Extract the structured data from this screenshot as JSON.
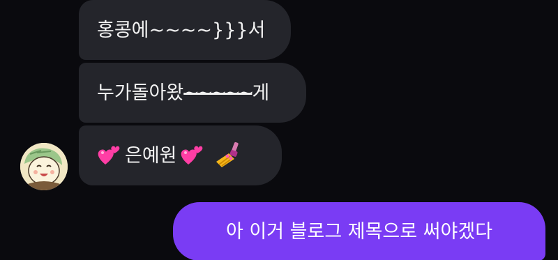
{
  "messages": {
    "m1": {
      "text": "홍콩에~~~~}}}서"
    },
    "m2": {
      "before": "누가돌아왔",
      "strike": "~~~~~",
      "after": "게"
    },
    "m3": {
      "emoji_left": "two-hearts-icon",
      "text": "은예원",
      "emoji_right": "two-hearts-icon",
      "emoji_end": "nail-polish-icon"
    },
    "m4": {
      "text": "아 이거 블로그 제목으로 써야겠다"
    }
  },
  "colors": {
    "background": "#0a0a0e",
    "incoming_bubble": "#24252b",
    "outgoing_bubble": "#7a3cf4",
    "text": "#f2f2f2"
  }
}
